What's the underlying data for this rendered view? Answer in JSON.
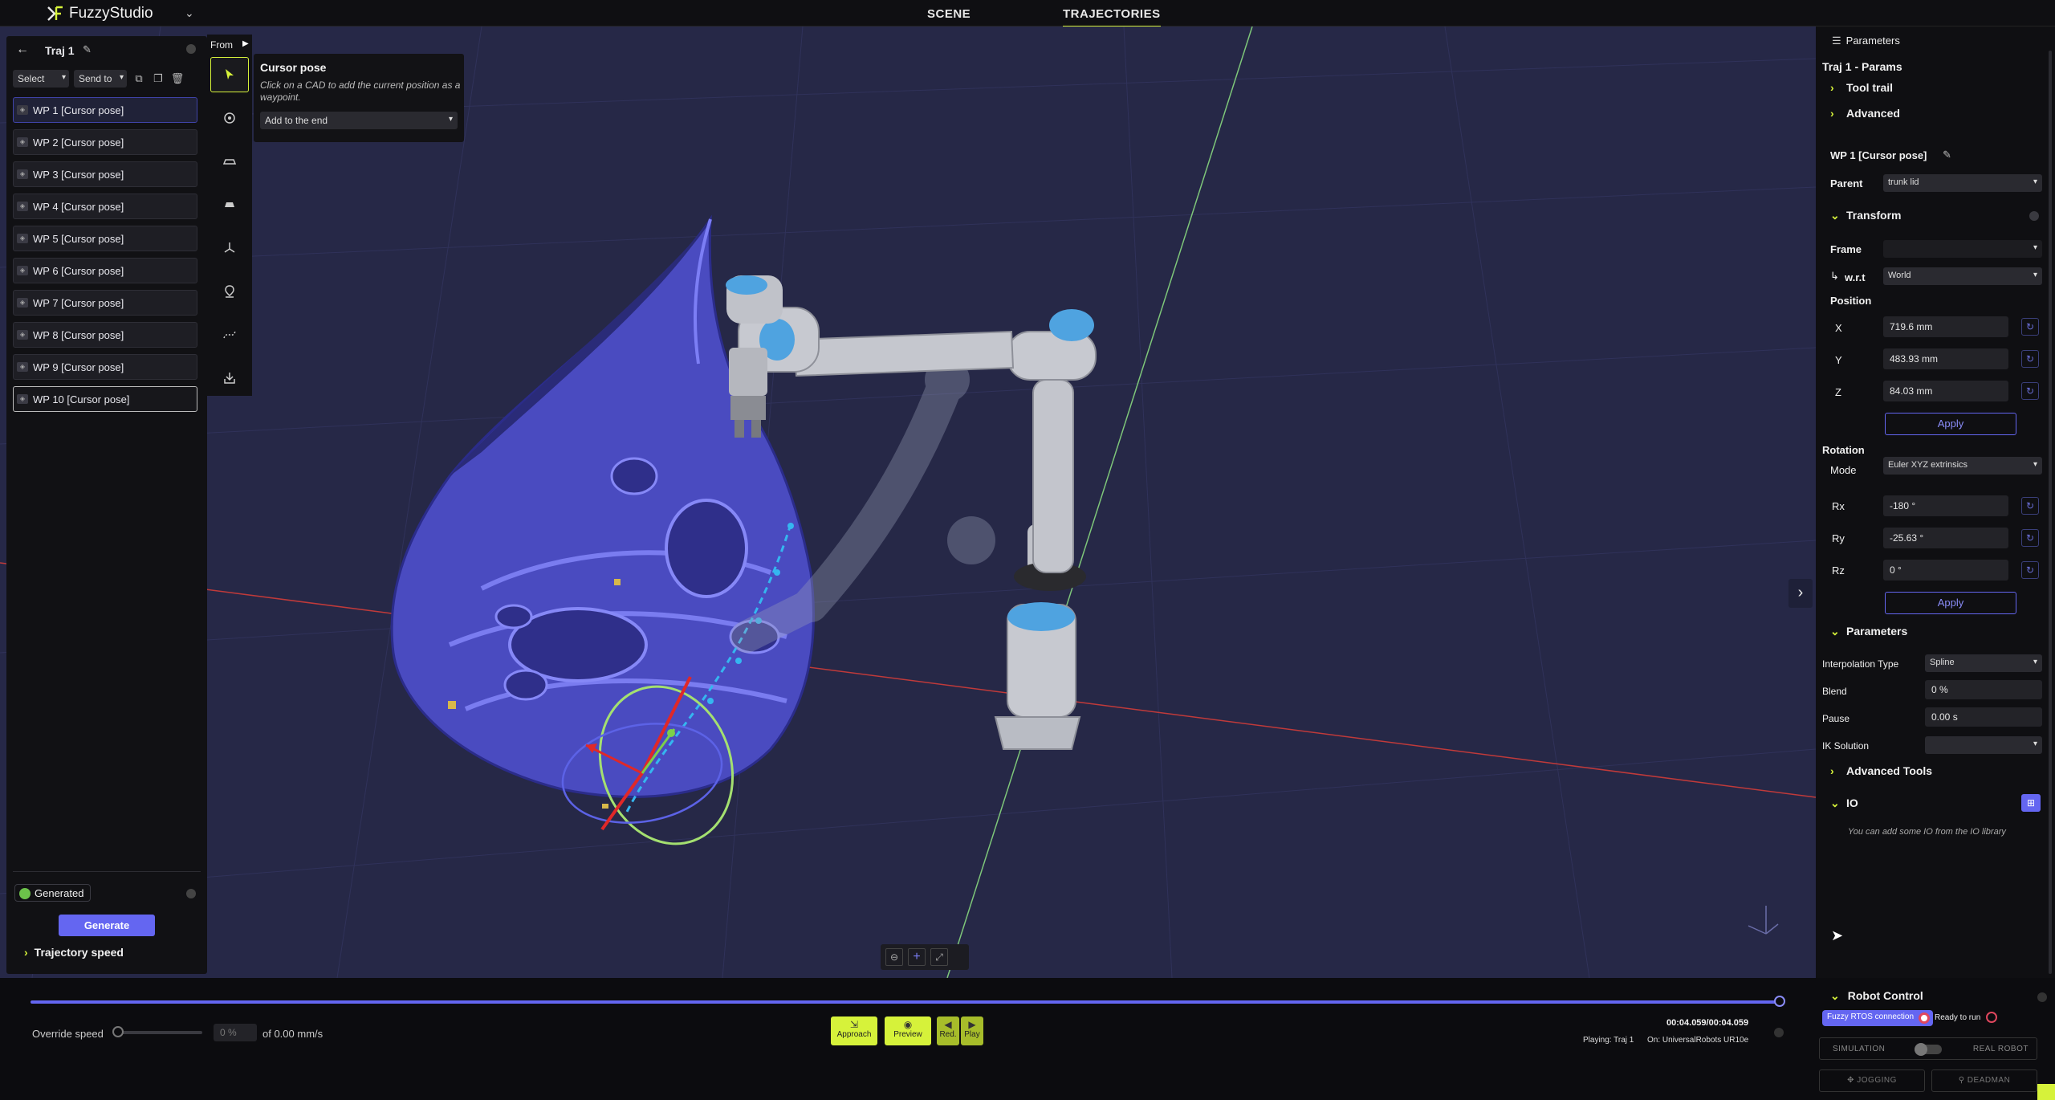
{
  "app": {
    "name": "FuzzyStudio"
  },
  "nav": {
    "tabs": [
      "SCENE",
      "TRAJECTORIES"
    ]
  },
  "left_panel": {
    "title": "Traj 1",
    "select_label": "Select",
    "send_label": "Send to",
    "waypoints": [
      "WP 1 [Cursor pose]",
      "WP 2 [Cursor pose]",
      "WP 3 [Cursor pose]",
      "WP 4 [Cursor pose]",
      "WP 5 [Cursor pose]",
      "WP 6 [Cursor pose]",
      "WP 7 [Cursor pose]",
      "WP 8 [Cursor pose]",
      "WP 9 [Cursor pose]",
      "WP 10 [Cursor pose]"
    ],
    "status": "Generated",
    "generate_label": "Generate",
    "speed_section": "Trajectory speed"
  },
  "toolstrip": {
    "from_label": "From"
  },
  "cursor_pose": {
    "title": "Cursor pose",
    "help": "Click on a CAD to add the current position as a waypoint.",
    "placement": "Add to the end"
  },
  "right_panel": {
    "tab": "Parameters",
    "heading": "Traj 1 - Params",
    "tool_trail": "Tool trail",
    "advanced": "Advanced",
    "wp_title": "WP 1 [Cursor pose]",
    "parent_label": "Parent",
    "parent_value": "trunk lid",
    "transform": "Transform",
    "frame_label": "Frame",
    "frame_value": "",
    "wrt_label": "w.r.t",
    "wrt_value": "World",
    "position_label": "Position",
    "x_label": "X",
    "x_value": "719.6  mm",
    "y_label": "Y",
    "y_value": "483.93  mm",
    "z_label": "Z",
    "z_value": "84.03  mm",
    "apply_label": "Apply",
    "rotation_label": "Rotation",
    "mode_label": "Mode",
    "mode_value": "Euler XYZ extrinsics",
    "rx_label": "Rx",
    "rx_value": "-180 °",
    "ry_label": "Ry",
    "ry_value": "-25.63 °",
    "rz_label": "Rz",
    "rz_value": "0 °",
    "parameters": "Parameters",
    "interp_label": "Interpolation Type",
    "interp_value": "Spline",
    "blend_label": "Blend",
    "blend_value": "0 %",
    "pause_label": "Pause",
    "pause_value": "0.00 s",
    "ik_label": "IK Solution",
    "ik_value": "",
    "advanced_tools": "Advanced Tools",
    "io_label": "IO",
    "io_hint": "You can add some IO from the IO library"
  },
  "timeline": {
    "progress": 1.0,
    "override_label": "Override speed",
    "override_value": "0 %",
    "of_speed": "of 0.00 mm/s",
    "approach": "Approach",
    "preview": "Preview",
    "red": "Red.",
    "play": "Play",
    "time": "00:04.059/00:04.059",
    "playing": "Playing: Traj 1",
    "on": "On: UniversalRobots UR10e"
  },
  "robot_control": {
    "title": "Robot Control",
    "connection": "Fuzzy RTOS connection",
    "ready": "Ready to run",
    "simulation": "SIMULATION",
    "real_robot": "REAL ROBOT",
    "jogging": "JOGGING",
    "deadman": "DEADMAN"
  },
  "colors": {
    "accent": "#d6f23a",
    "primary": "#6466f1",
    "viewport": "#262847",
    "panel": "#111114"
  }
}
